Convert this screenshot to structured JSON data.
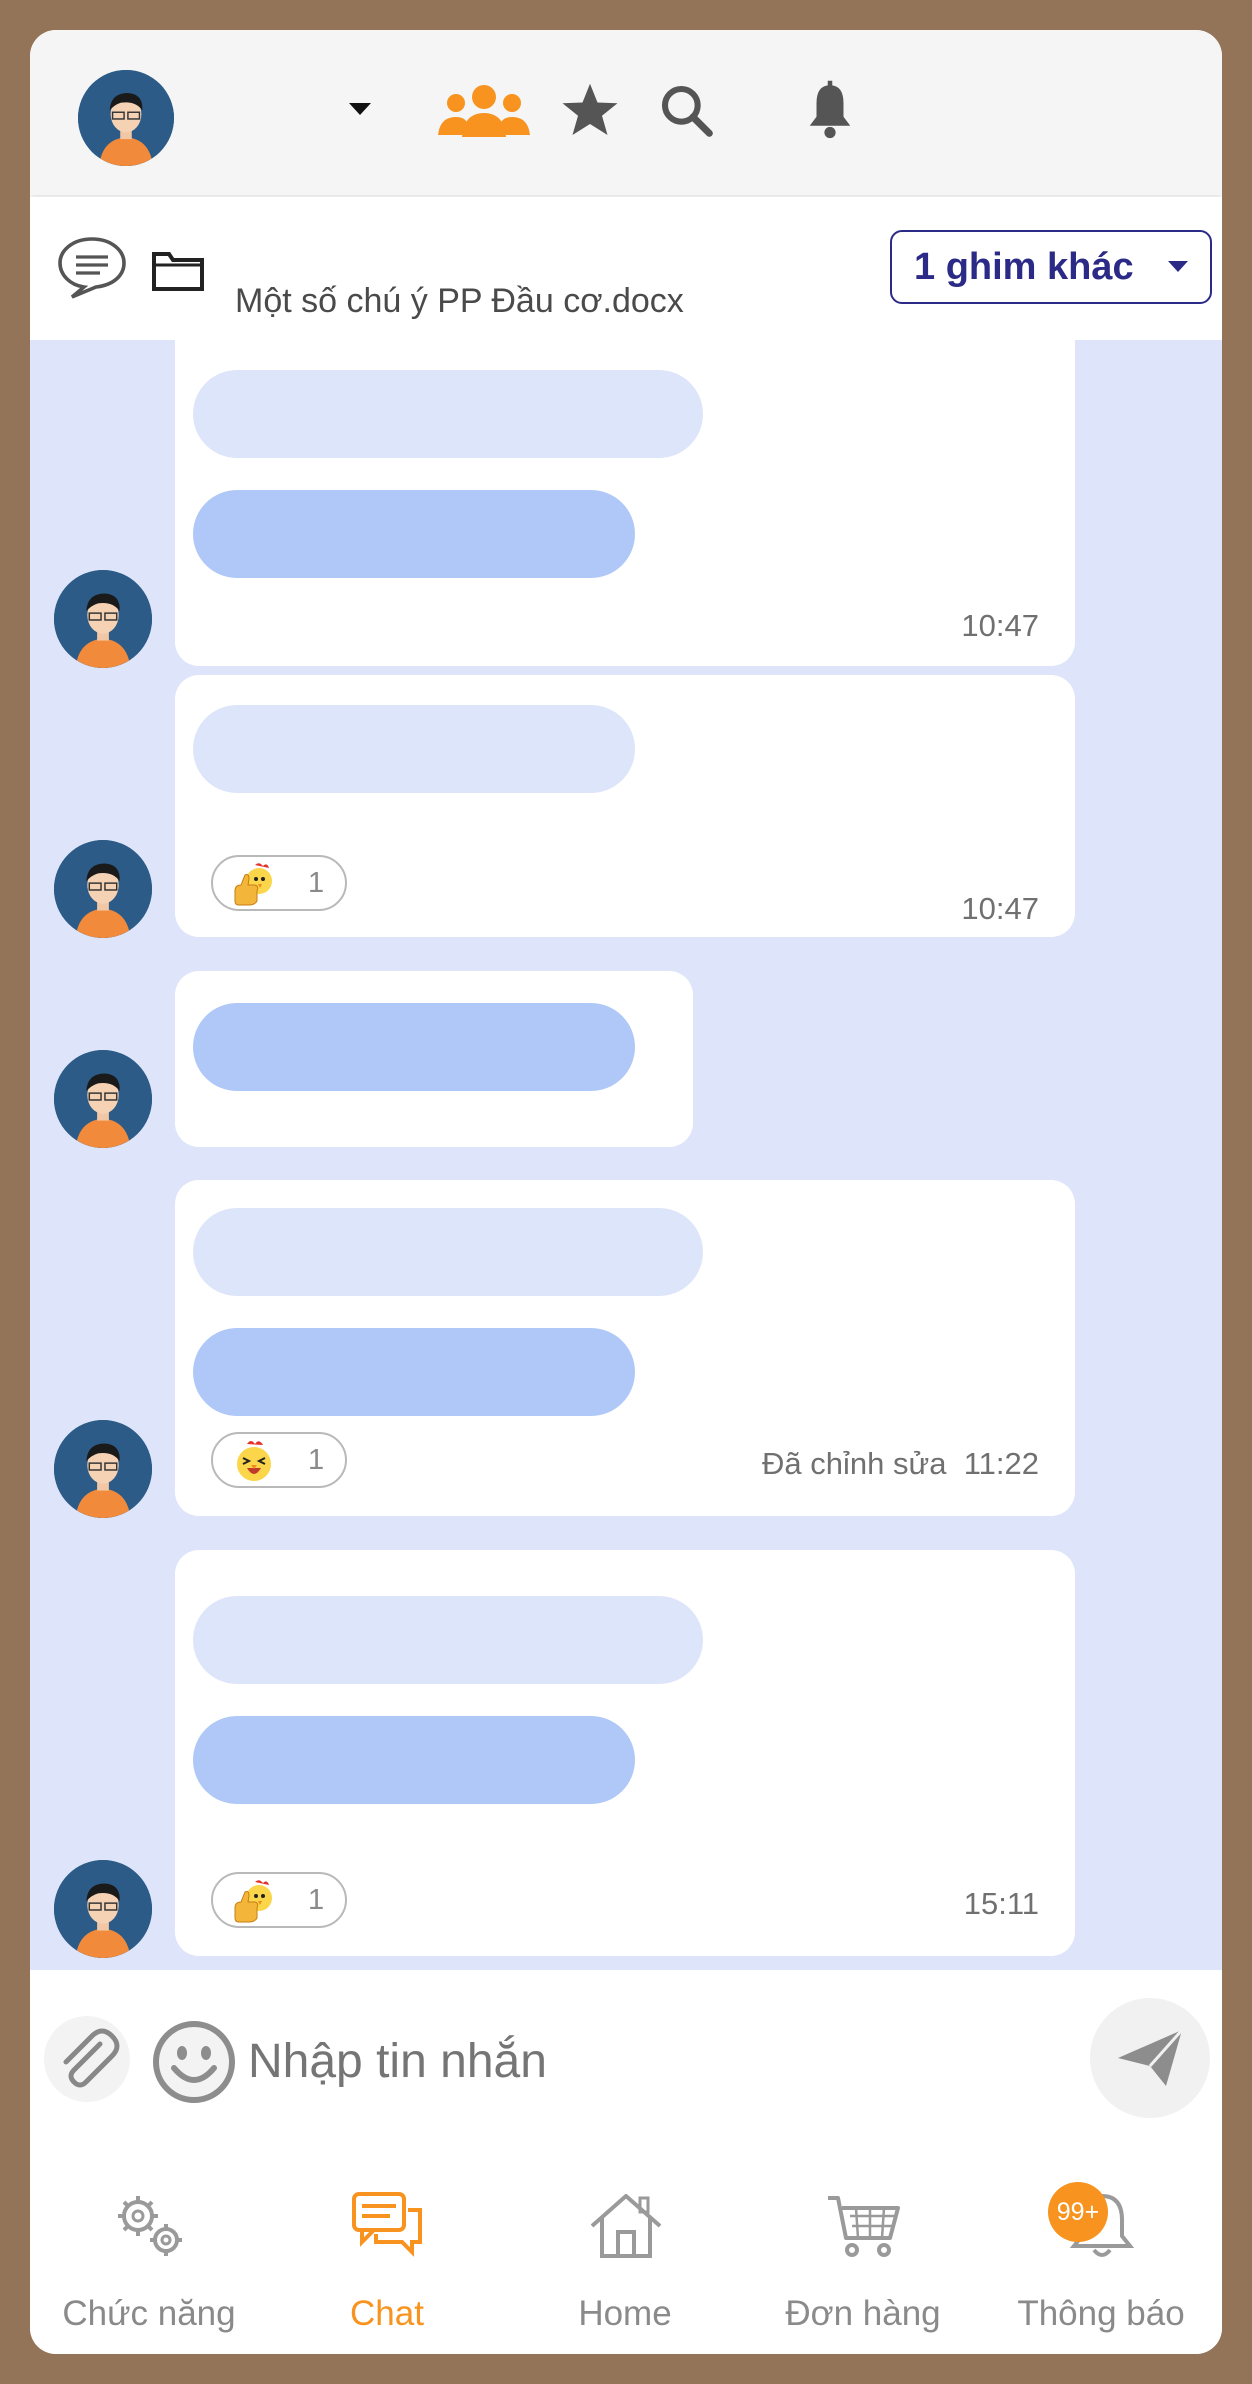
{
  "colors": {
    "frame_border": "#937459",
    "accent_orange": "#f7931e",
    "chat_background": "#dee5fa",
    "pin_accent": "#2b2a86"
  },
  "header": {
    "icons": [
      "avatar",
      "dropdown-caret-icon",
      "group-icon",
      "star-icon",
      "search-icon",
      "bell-icon"
    ]
  },
  "pin": {
    "file_name": "Một số chú ý PP Đầu cơ.docx",
    "other_pins_label": "1 ghim khác"
  },
  "messages": [
    {
      "time": "10:47",
      "edited": "",
      "reaction_count": ""
    },
    {
      "time": "10:47",
      "edited": "",
      "reaction_emoji": "thumbs-up-chicken",
      "reaction_count": "1"
    },
    {
      "time": "",
      "edited": "",
      "reaction_count": ""
    },
    {
      "time": "11:22",
      "edited": "Đã chỉnh sửa",
      "reaction_emoji": "laughing-chicken",
      "reaction_count": "1"
    },
    {
      "time": "15:11",
      "edited": "",
      "reaction_emoji": "thumbs-up-chicken",
      "reaction_count": "1"
    }
  ],
  "composer": {
    "placeholder": "Nhập tin nhắn"
  },
  "nav": {
    "items": [
      {
        "label": "Chức năng",
        "icon": "gears-icon"
      },
      {
        "label": "Chat",
        "icon": "chat-icon",
        "active": true
      },
      {
        "label": "Home",
        "icon": "home-icon"
      },
      {
        "label": "Đơn hàng",
        "icon": "cart-icon"
      },
      {
        "label": "Thông báo",
        "icon": "bell-icon"
      }
    ],
    "notification_badge": "99+"
  }
}
